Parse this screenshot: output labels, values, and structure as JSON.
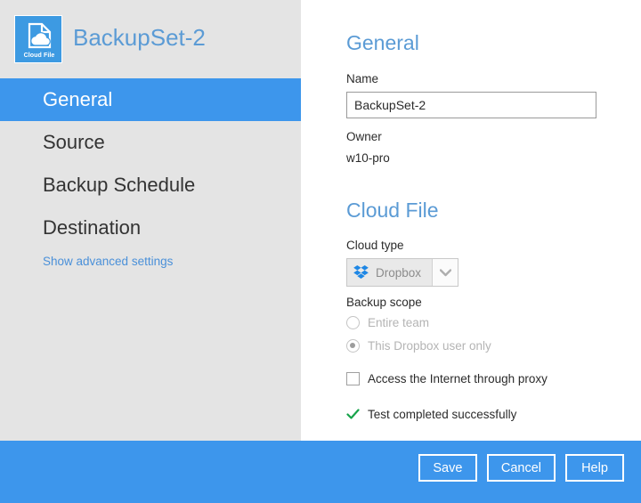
{
  "window": {
    "accent_blue": "#3d96ec",
    "heading_blue": "#5b9bd5",
    "sidebar_bg": "#e4e4e4",
    "success_green": "#17a34a"
  },
  "sidebar": {
    "brand": {
      "icon_name": "cloud-file-icon",
      "icon_caption": "Cloud File",
      "title": "BackupSet-2"
    },
    "items": [
      {
        "label": "General",
        "active": true
      },
      {
        "label": "Source",
        "active": false
      },
      {
        "label": "Backup Schedule",
        "active": false
      },
      {
        "label": "Destination",
        "active": false
      }
    ],
    "advanced_link": "Show advanced settings"
  },
  "main": {
    "general": {
      "title": "General",
      "name_label": "Name",
      "name_value": "BackupSet-2",
      "name_placeholder": "Name",
      "owner_label": "Owner",
      "owner_value": "w10-pro"
    },
    "cloud_file": {
      "title": "Cloud File",
      "cloud_type_label": "Cloud type",
      "cloud_type_value": "Dropbox",
      "cloud_type_icon": "dropbox-icon",
      "dropdown_icon": "chevron-down-icon",
      "backup_scope_label": "Backup scope",
      "scope_options": [
        {
          "label": "Entire team",
          "selected": false
        },
        {
          "label": "This Dropbox user only",
          "selected": true
        }
      ],
      "proxy_label": "Access the Internet through proxy",
      "proxy_checked": false,
      "status_icon": "check-mark-icon",
      "status_text": "Test completed successfully"
    }
  },
  "footer": {
    "save_label": "Save",
    "cancel_label": "Cancel",
    "help_label": "Help"
  }
}
